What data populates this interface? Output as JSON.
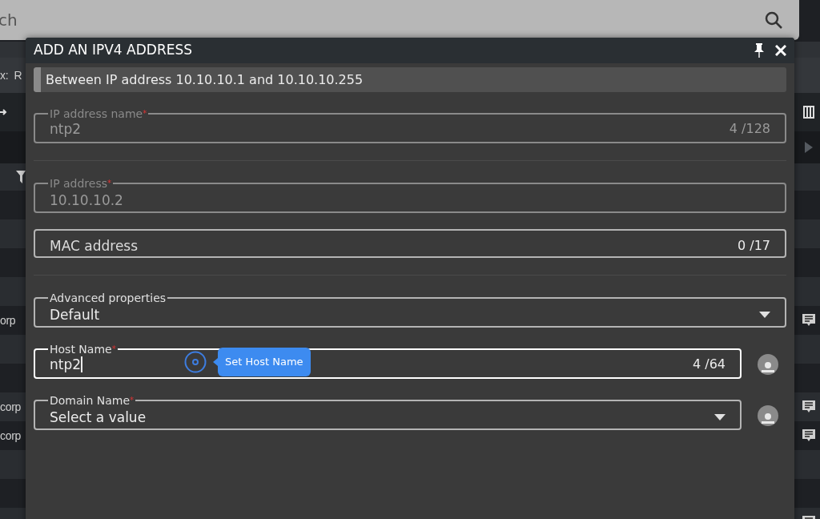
{
  "background": {
    "search": {
      "text": "ch"
    },
    "left_strip": [
      {
        "kind": "text",
        "text": "x:  R"
      },
      {
        "kind": "arrow"
      },
      {
        "kind": "filter"
      },
      {
        "kind": "text",
        "text": "orp"
      },
      {
        "kind": "text",
        "text": "corp"
      },
      {
        "kind": "text",
        "text": "corp"
      }
    ],
    "right_strip": [
      {
        "kind": "columns"
      },
      {
        "kind": "play"
      },
      {
        "kind": "comment"
      },
      {
        "kind": "comment"
      },
      {
        "kind": "comment"
      },
      {
        "kind": "comment"
      }
    ]
  },
  "dialog": {
    "title": "ADD AN IPV4 ADDRESS",
    "pinned": true,
    "banner": "Between IP address 10.10.10.1 and 10.10.10.255",
    "fields": [
      {
        "kind": "text",
        "label": "IP address name",
        "required_mark": "*",
        "value": "ntp2",
        "counter": "4 /128",
        "disabled": true,
        "focused": false,
        "divider_after": true
      },
      {
        "kind": "text",
        "label": "IP address",
        "required_mark": "*",
        "value": "10.10.10.2",
        "disabled": true,
        "focused": false
      },
      {
        "kind": "text",
        "placeholder": "MAC address",
        "counter": "0 /17",
        "disabled": false,
        "focused": false,
        "divider_after": true
      },
      {
        "kind": "select",
        "label": "Advanced properties",
        "value": "Default",
        "disabled": false,
        "focused": false
      },
      {
        "kind": "text",
        "label": "Host Name",
        "required_mark": "*",
        "value": "ntp2",
        "counter": "4 /64",
        "disabled": false,
        "focused": true,
        "side_button": true,
        "tooltip": "Set Host Name"
      },
      {
        "kind": "select",
        "label": "Domain Name",
        "required_mark": "*",
        "value": "Select a value",
        "disabled": false,
        "focused": false,
        "side_button": true
      }
    ]
  }
}
